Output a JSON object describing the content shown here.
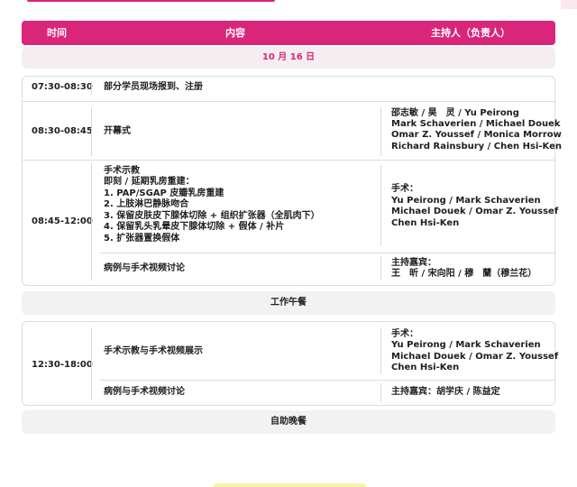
{
  "header": {
    "time": "时间",
    "content": "内容",
    "host": "主持人（负责人）"
  },
  "date": "10 月 16 日",
  "rows": [
    {
      "time": "07:30-08:30",
      "content": "部分学员现场报到、注册"
    },
    {
      "time": "08:30-08:45",
      "content": "开幕式",
      "hosts": [
        "邵志敏 / 昊　灵 / Yu Peirong",
        "Mark Schaverien / Michael Douek",
        "Omar Z. Youssef / Monica Morrow",
        "Richard Rainsbury / Chen Hsi-Ken"
      ]
    },
    {
      "time": "08:45-12:00",
      "content_lines": [
        "手术示教",
        "即刻 / 延期乳房重建：",
        "1. PAP/SGAP 皮瓣乳房重建",
        "2. 上肢淋巴静脉吻合",
        "3. 保留皮肤皮下腺体切除 + 组织扩张器（全肌肉下）",
        "4. 保留乳头乳晕皮下腺体切除 + 假体 / 补片",
        "5. 扩张器置换假体"
      ],
      "hosts": [
        "手术：",
        "Yu Peirong / Mark Schaverien",
        "Michael Douek / Omar Z. Youssef",
        "Chen Hsi-Ken"
      ],
      "sub_content": "病例与手术视频讨论",
      "sub_hosts": [
        "主持嘉宾：",
        "王　昕 / 宋向阳 / 穆　蘭（穆兰花）"
      ]
    }
  ],
  "lunch": "工作午餐",
  "afternoon": {
    "time": "12:30-18:00",
    "content": "手术示教与手术视频展示",
    "hosts": [
      "手术：",
      "Yu Peirong / Mark Schaverien",
      "Michael Douek / Omar Z. Youssef",
      "Chen Hsi-Ken"
    ],
    "sub_content": "病例与手术视频讨论",
    "sub_hosts": "主持嘉宾：胡学庆 / 陈益定"
  },
  "dinner": "自助晚餐"
}
